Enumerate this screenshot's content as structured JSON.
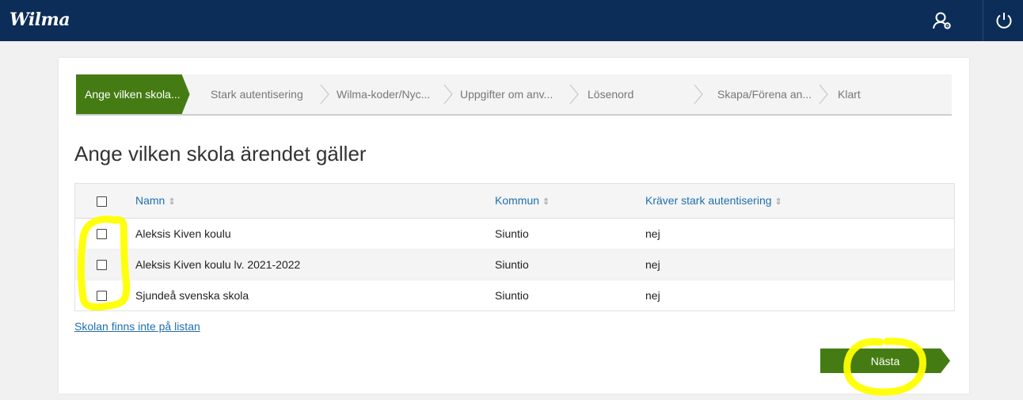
{
  "header": {
    "logo": "Wilma",
    "user_icon": "user-settings-icon",
    "power_icon": "power-icon",
    "bg_color": "#0c2d57"
  },
  "steps": [
    {
      "label": "Ange vilken skola...",
      "active": true
    },
    {
      "label": "Stark autentisering",
      "active": false
    },
    {
      "label": "Wilma-koder/Nyc...",
      "active": false
    },
    {
      "label": "Uppgifter om anv...",
      "active": false
    },
    {
      "label": "Lösenord",
      "active": false
    },
    {
      "label": "Skapa/Förena an...",
      "active": false
    },
    {
      "label": "Klart",
      "active": false
    }
  ],
  "page_title": "Ange vilken skola ärendet gäller",
  "table": {
    "columns": [
      "Namn",
      "Kommun",
      "Kräver stark autentisering"
    ],
    "sort_icon": "sort-icon",
    "rows": [
      {
        "name": "Aleksis Kiven koulu",
        "kommun": "Siuntio",
        "stark": "nej"
      },
      {
        "name": "Aleksis Kiven koulu lv. 2021-2022",
        "kommun": "Siuntio",
        "stark": "nej"
      },
      {
        "name": "Sjundeå svenska skola",
        "kommun": "Siuntio",
        "stark": "nej"
      }
    ]
  },
  "school_not_listed_link": "Skolan finns inte på listan",
  "next_button": "Nästa",
  "accent_color": "#447c13",
  "highlight_color": "#ffff00"
}
